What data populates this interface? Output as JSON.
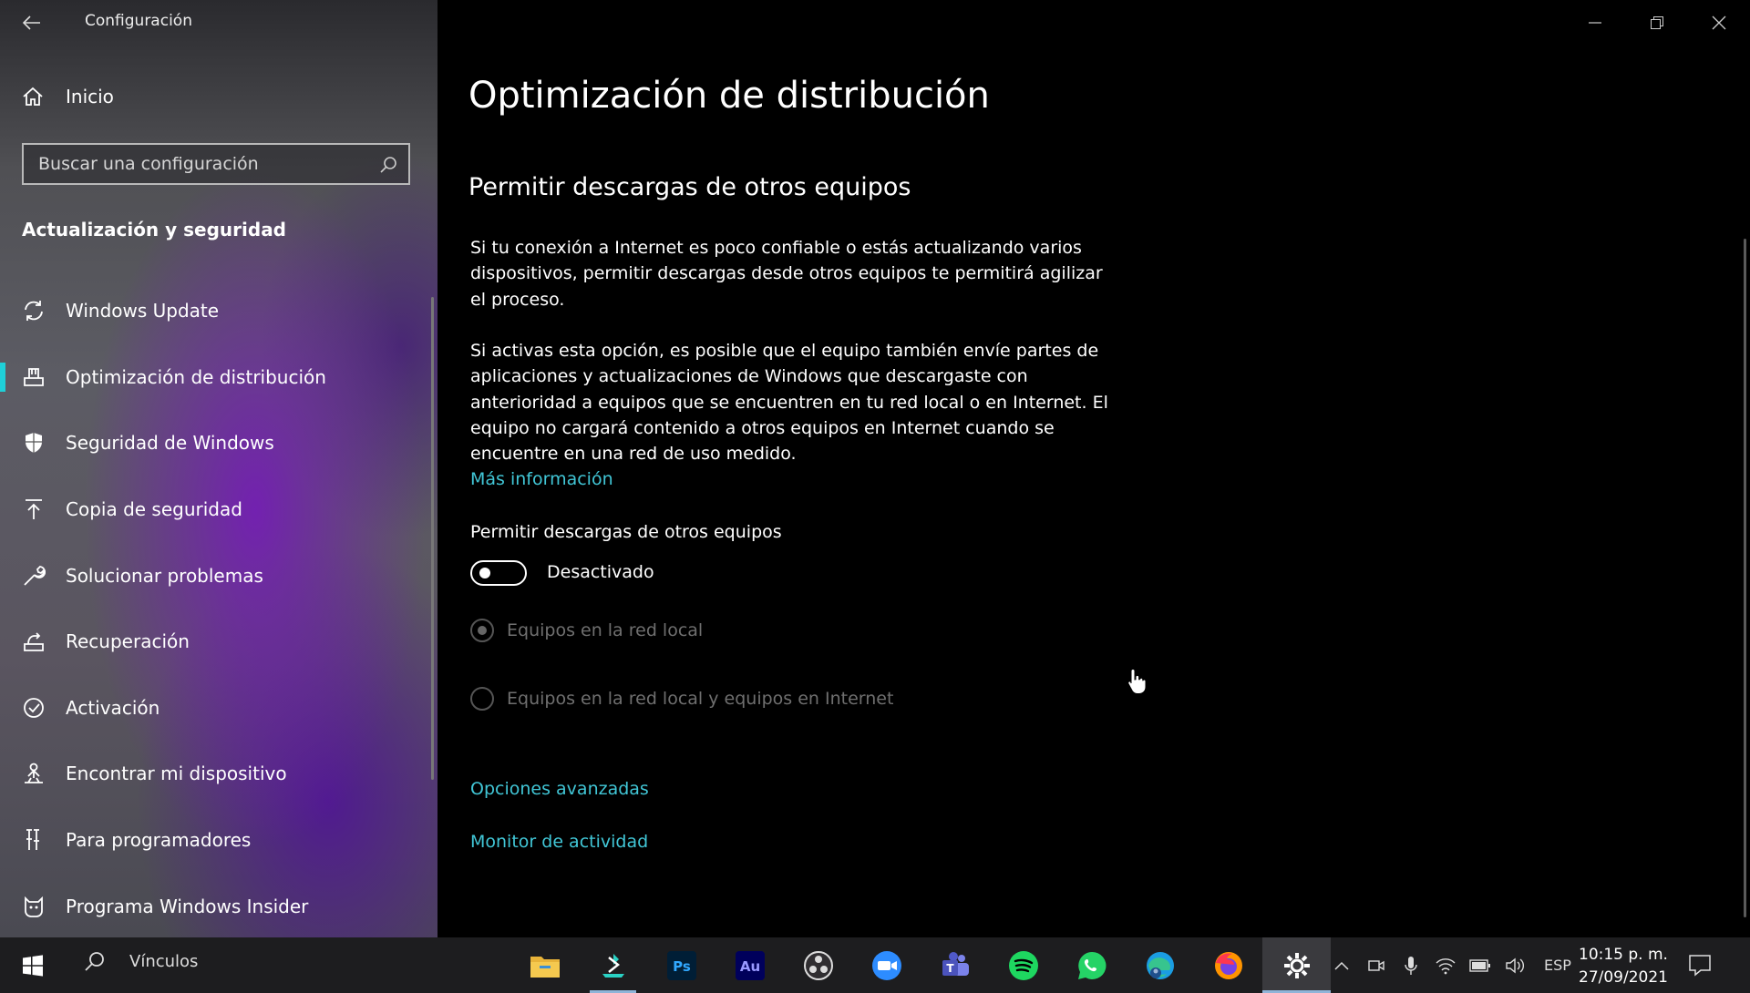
{
  "app": {
    "title": "Configuración"
  },
  "sidebar": {
    "home_label": "Inicio",
    "search_placeholder": "Buscar una configuración",
    "section_title": "Actualización y seguridad",
    "items": [
      {
        "label": "Windows Update",
        "icon": "refresh-icon"
      },
      {
        "label": "Optimización de distribución",
        "icon": "delivery-optimization-icon",
        "active": true
      },
      {
        "label": "Seguridad de Windows",
        "icon": "shield-icon"
      },
      {
        "label": "Copia de seguridad",
        "icon": "upload-icon"
      },
      {
        "label": "Solucionar problemas",
        "icon": "wrench-icon"
      },
      {
        "label": "Recuperación",
        "icon": "recovery-icon"
      },
      {
        "label": "Activación",
        "icon": "check-circle-icon"
      },
      {
        "label": "Encontrar mi dispositivo",
        "icon": "person-location-icon"
      },
      {
        "label": "Para programadores",
        "icon": "developer-tools-icon"
      },
      {
        "label": "Programa Windows Insider",
        "icon": "insider-cat-icon"
      }
    ]
  },
  "main": {
    "title": "Optimización de distribución",
    "subtitle": "Permitir descargas de otros equipos",
    "para1": "Si tu conexión a Internet es poco confiable o estás actualizando varios dispositivos, permitir descargas desde otros equipos te permitirá agilizar el proceso.",
    "para2": "Si activas esta opción, es posible que el equipo también envíe partes de aplicaciones y actualizaciones de Windows que descargaste con anterioridad a equipos que se encuentren en tu red local o en Internet. El equipo no cargará contenido a otros equipos en Internet cuando se encuentre en una red de uso medido.",
    "more_info": "Más información",
    "toggle_label": "Permitir descargas de otros equipos",
    "toggle_state": "Desactivado",
    "radio_local": "Equipos en la red local",
    "radio_internet": "Equipos en la red local y equipos en Internet",
    "advanced": "Opciones avanzadas",
    "activity": "Monitor de actividad"
  },
  "taskbar": {
    "search_label": "Vínculos",
    "apps": [
      "file-explorer",
      "installer",
      "photoshop",
      "audition",
      "obs",
      "zoom",
      "teams",
      "spotify",
      "whatsapp",
      "edge",
      "firefox",
      "settings"
    ],
    "language": "ESP",
    "time": "10:15 p. m.",
    "date": "27/09/2021"
  },
  "colors": {
    "accent": "#41c6d6",
    "active_indicator": "#1fd0d8"
  }
}
